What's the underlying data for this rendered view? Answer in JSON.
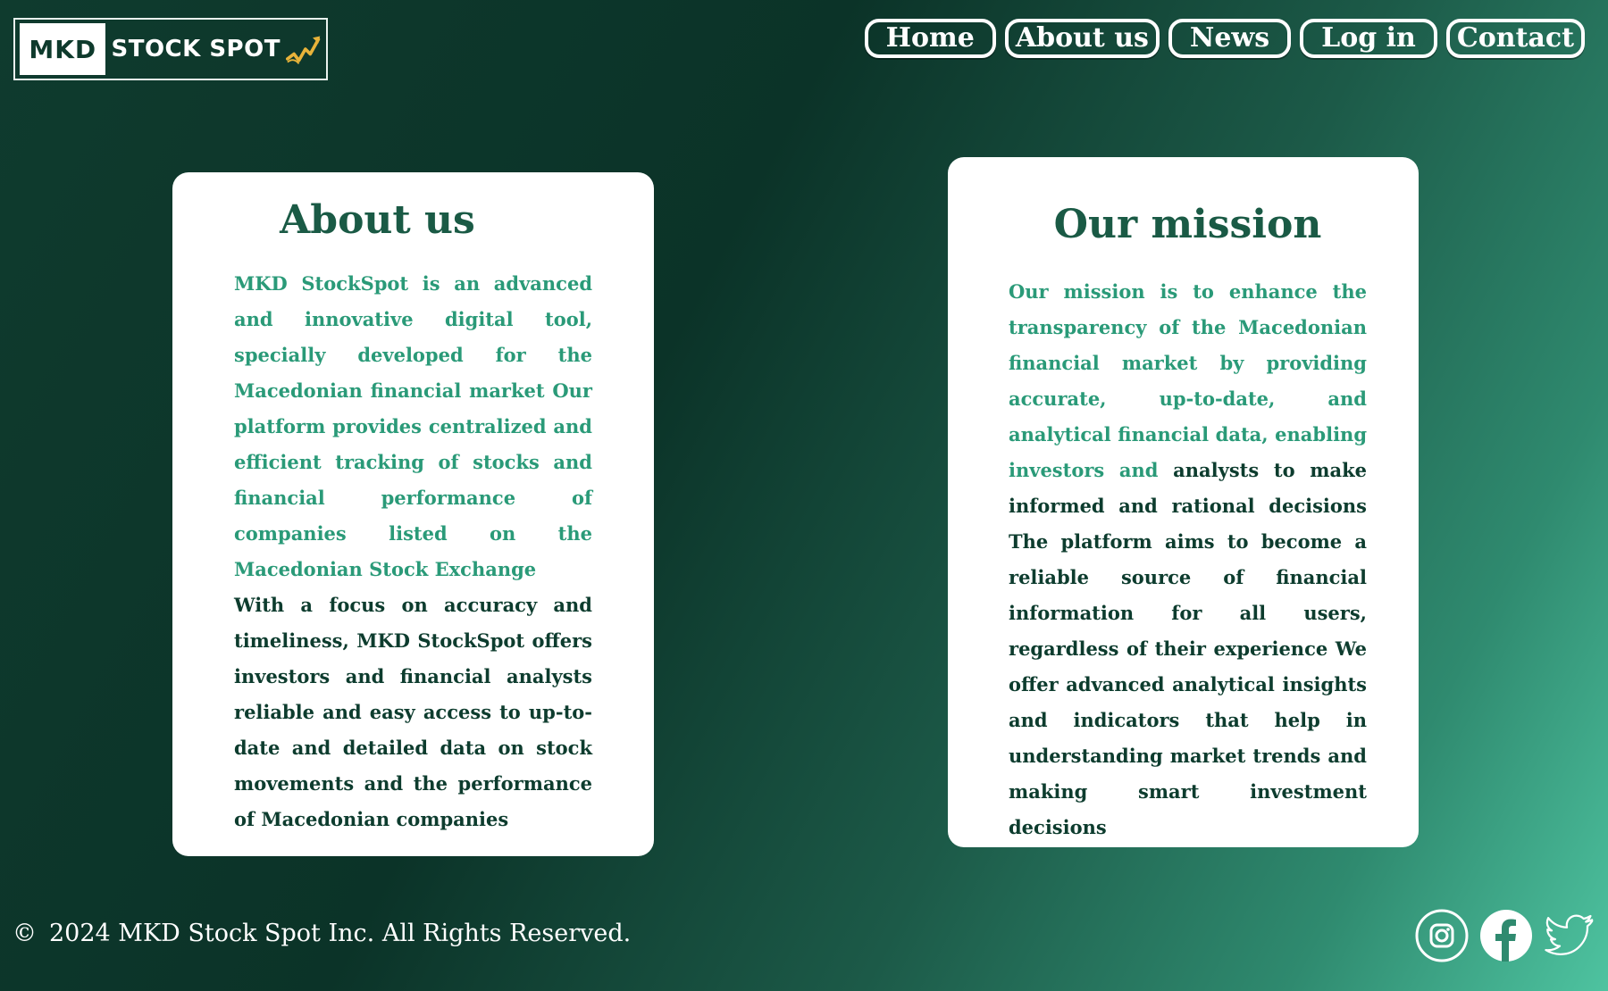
{
  "logo": {
    "mkd": "MKD",
    "text": "STOCK SPOT"
  },
  "nav": {
    "home": "Home",
    "about": "About us",
    "news": "News",
    "login": "Log in",
    "contact": "Contact"
  },
  "about": {
    "title": "About us",
    "accent_text": "MKD StockSpot is an advanced and innovative digital tool, specially developed for the Macedonian financial market Our platform provides centralized and efficient tracking of stocks and financial performance of companies listed on the Macedonian Stock Exchange",
    "body_text": "With a focus on accuracy and timeliness, MKD StockSpot offers investors and financial analysts reliable and easy access to up-to-date and detailed data on stock movements and the performance of Macedonian companies"
  },
  "mission": {
    "title": "Our mission",
    "accent_text": "Our mission is to enhance the transparency of the Macedonian financial market by providing accurate, up-to-date, and analytical financial data, enabling investors and analysts to make informed and rational decisions The platform aims to become a reliable source of financial information for all users, regardless of their experience We offer advanced analytical insights and indicators that help in understanding market trends and making smart investment decisions"
  },
  "footer": {
    "copyright_symbol": "©",
    "copyright": "2024 MKD Stock Spot Inc. All Rights Reserved."
  },
  "socials": [
    "instagram-icon",
    "facebook-icon",
    "twitter-icon"
  ],
  "colors": {
    "accent": "#2a9a78",
    "title": "#1a5a45",
    "body": "#0d3c2e",
    "logo_arrow": "#e8b33a"
  }
}
